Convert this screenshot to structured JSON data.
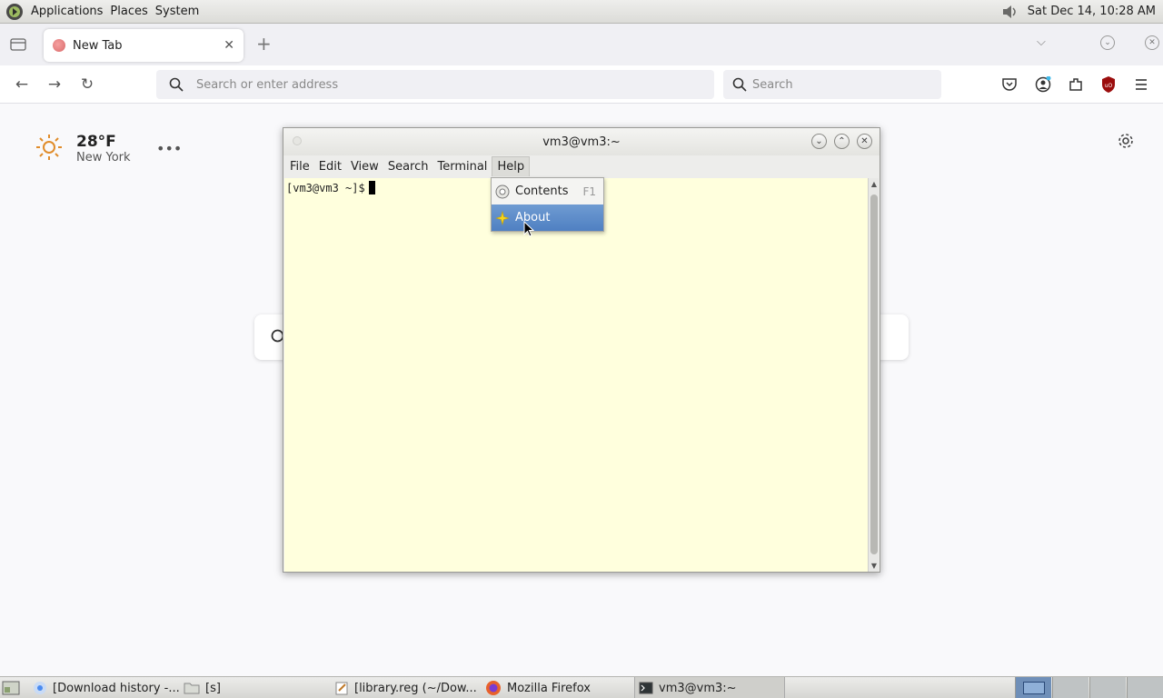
{
  "top_panel": {
    "menus": [
      "Applications",
      "Places",
      "System"
    ],
    "clock": "Sat Dec 14, 10:28 AM"
  },
  "browser": {
    "tab": {
      "title": "New Tab"
    },
    "url_placeholder": "Search or enter address",
    "search_placeholder": "Search",
    "weather": {
      "temp": "28°F",
      "city": "New York"
    }
  },
  "terminal": {
    "title": "vm3@vm3:~",
    "menus": [
      "File",
      "Edit",
      "View",
      "Search",
      "Terminal",
      "Help"
    ],
    "prompt": "[vm3@vm3 ~]$",
    "help_menu": {
      "items": [
        {
          "label": "Contents",
          "accel": "F1"
        },
        {
          "label": "About",
          "accel": ""
        }
      ]
    }
  },
  "taskbar": {
    "items": [
      {
        "label": "[Download history -..."
      },
      {
        "label": "[s]"
      },
      {
        "label": "[library.reg (~/Dow..."
      },
      {
        "label": "Mozilla Firefox"
      },
      {
        "label": "vm3@vm3:~"
      }
    ]
  },
  "colors": {
    "terminal_bg": "#ffffdd",
    "menu_highlight": "#4f80c2"
  }
}
